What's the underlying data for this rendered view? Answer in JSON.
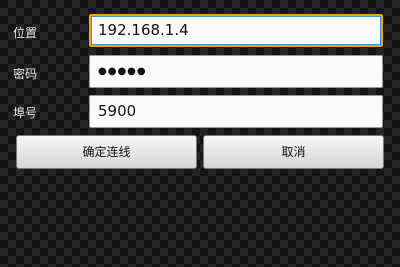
{
  "form": {
    "address_label": "位置",
    "address_value": "192.168.1.4",
    "password_label": "密码",
    "password_value": "●●●●●",
    "port_label": "埠号",
    "port_value": "5900"
  },
  "buttons": {
    "connect_label": "确定连线",
    "cancel_label": "取消"
  },
  "colors": {
    "focus_border": "#f0a30a",
    "background": "#141414"
  }
}
